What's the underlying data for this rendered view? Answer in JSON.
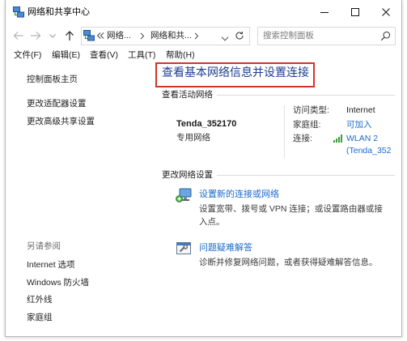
{
  "window": {
    "title": "网络和共享中心"
  },
  "address_bar": {
    "crumbs": [
      "网络...",
      "网络和共..."
    ],
    "search_placeholder": "搜索控制面板"
  },
  "menu": [
    "文件(F)",
    "编辑(E)",
    "查看(V)",
    "工具(T)",
    "帮助(H)"
  ],
  "sidebar": {
    "tasks": [
      "控制面板主页",
      "更改适配器设置",
      "更改高级共享设置"
    ],
    "see_also_label": "另请参阅",
    "see_also": [
      "Internet 选项",
      "Windows 防火墙",
      "红外线",
      "家庭组"
    ]
  },
  "main": {
    "title": "查看基本网络信息并设置连接",
    "active_networks": {
      "section_label": "查看活动网络",
      "network_name": "Tenda_352170",
      "network_category": "专用网络",
      "access_type_label": "访问类型:",
      "access_type_value": "Internet",
      "homegroup_label": "家庭组:",
      "homegroup_value": "可加入",
      "connections_label": "连接:",
      "connection_name": "WLAN 2",
      "connection_ssid": "(Tenda_352"
    },
    "change_settings": {
      "section_label": "更改网络设置",
      "tasks": [
        {
          "title": "设置新的连接或网络",
          "description": "设置宽带、拨号或 VPN 连接；或设置路由器或接入点。"
        },
        {
          "title": "问题疑难解答",
          "description": "诊断并修复网络问题，或者获得疑难解答信息。"
        }
      ]
    }
  },
  "icons": {
    "window": "network-center-icon",
    "controls": [
      "minimize-icon",
      "maximize-icon",
      "close-icon"
    ],
    "nav": [
      "arrow-left-icon",
      "arrow-right-icon",
      "chevron-down-icon",
      "arrow-up-icon"
    ],
    "address": [
      "network-location-icon",
      "double-chevron-left-icon",
      "chevron-right-icon",
      "refresh-icon"
    ],
    "search": "search-icon",
    "connection": "wifi-signal-icon",
    "tasks": [
      "new-connection-icon",
      "troubleshoot-icon"
    ]
  },
  "colors": {
    "link": "#1a6bcc",
    "heading": "#1e3d91",
    "highlight": "#d4332c",
    "signal": "#3a9e3a"
  }
}
